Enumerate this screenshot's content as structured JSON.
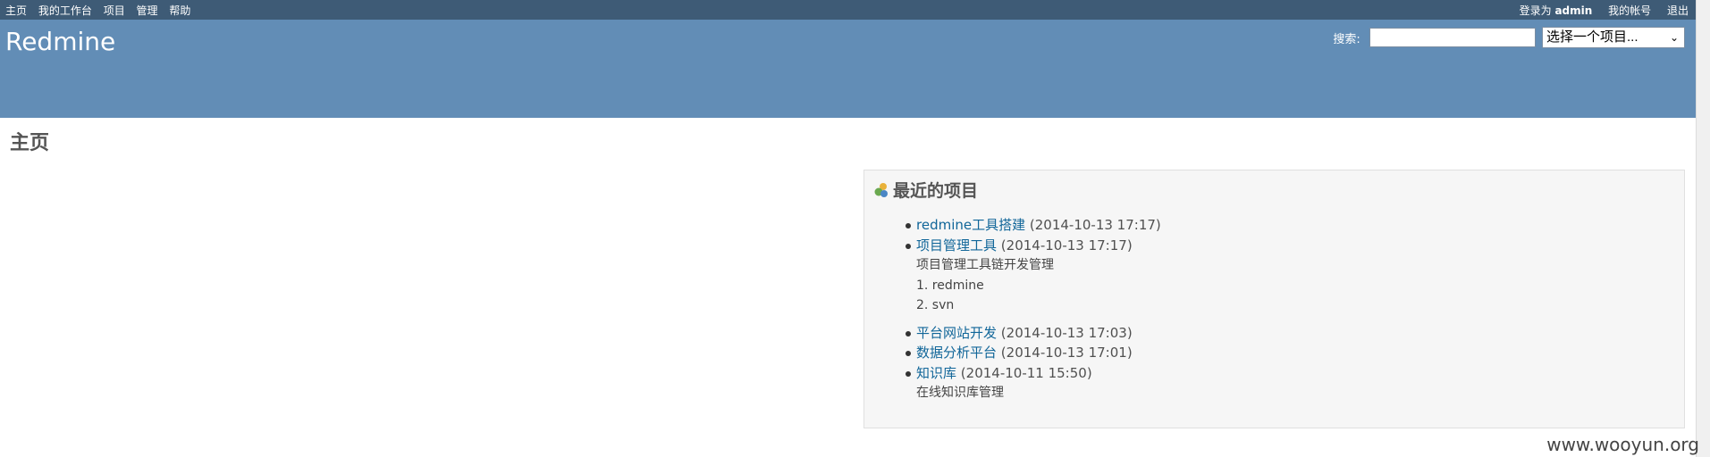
{
  "top_menu": {
    "items": [
      "主页",
      "我的工作台",
      "项目",
      "管理",
      "帮助"
    ],
    "logged_as_label": "登录为",
    "logged_user": "admin",
    "my_account": "我的帐号",
    "logout": "退出"
  },
  "header": {
    "title": "Redmine",
    "search_label": "搜索:",
    "search_value": "",
    "project_select": "选择一个项目..."
  },
  "main": {
    "page_title": "主页",
    "recent_projects": {
      "title": "最近的项目",
      "projects": [
        {
          "name": "redmine工具搭建",
          "date": "(2014-10-13 17:17)"
        },
        {
          "name": "项目管理工具",
          "date": "(2014-10-13 17:17)",
          "desc": "项目管理工具链开发管理",
          "list": [
            "1. redmine",
            "2. svn"
          ]
        },
        {
          "name": "平台网站开发",
          "date": "(2014-10-13 17:03)"
        },
        {
          "name": "数据分析平台",
          "date": "(2014-10-13 17:01)"
        },
        {
          "name": "知识库",
          "date": "(2014-10-11 15:50)",
          "desc": "在线知识库管理"
        }
      ]
    }
  },
  "watermark": "www.wooyun.org",
  "colors": {
    "top_bar": "#3e5b76",
    "header": "#628db6",
    "link": "#116699"
  }
}
